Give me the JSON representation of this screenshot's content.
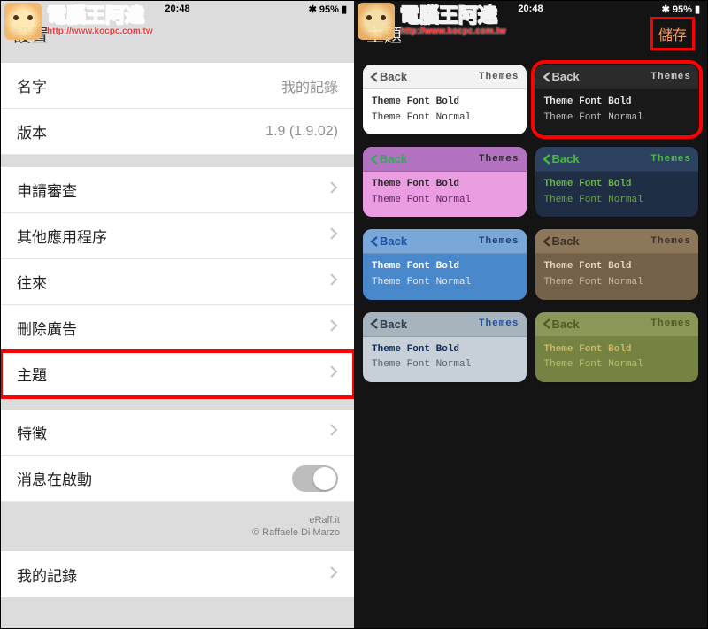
{
  "status": {
    "time": "20:48",
    "battery": "95%",
    "bt": "✱"
  },
  "watermark": {
    "title": "電腦王阿達",
    "url": "http://www.kocpc.com.tw"
  },
  "settings": {
    "title": "設置",
    "rows": {
      "name_label": "名字",
      "name_value": "我的記錄",
      "version_label": "版本",
      "version_value": "1.9 (1.9.02)",
      "review": "申請審查",
      "other_apps": "其他應用程序",
      "history": "往來",
      "remove_ads": "刪除廣告",
      "theme": "主題",
      "features": "特徵",
      "msg_on_start": "消息在啟動",
      "my_records": "我的記錄"
    },
    "credits": {
      "line1": "eRaff.it",
      "line2": "© Raffaele Di Marzo"
    }
  },
  "themes": {
    "title": "主題",
    "save": "儲存",
    "card": {
      "back": "Back",
      "header": "Themes",
      "bold": "Theme Font Bold",
      "normal": "Theme Font Normal"
    }
  }
}
